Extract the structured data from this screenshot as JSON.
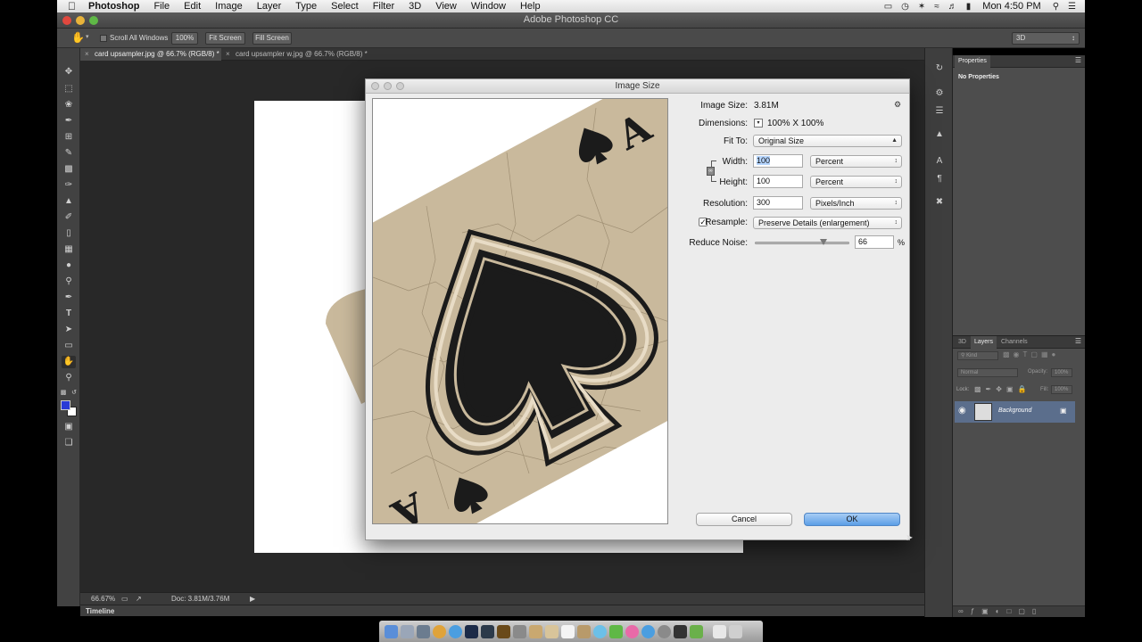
{
  "menubar": {
    "app_name": "Photoshop",
    "menus": [
      "File",
      "Edit",
      "Image",
      "Layer",
      "Type",
      "Select",
      "Filter",
      "3D",
      "View",
      "Window",
      "Help"
    ],
    "clock": "Mon 4:50 PM"
  },
  "window": {
    "title": "Adobe Photoshop CC"
  },
  "options_bar": {
    "scroll_all_windows": "Scroll All Windows",
    "zoom_btn": "100%",
    "fit_screen_btn": "Fit Screen",
    "fill_screen_btn": "Fill Screen",
    "workspace": "3D"
  },
  "tabs": [
    {
      "label": "card upsampler.jpg @ 66.7% (RGB/8) *"
    },
    {
      "label": "card upsampler w.jpg @ 66.7% (RGB/8) *"
    }
  ],
  "status": {
    "zoom": "66.67%",
    "doc": "Doc: 3.81M/3.76M",
    "timeline": "Timeline"
  },
  "properties_panel": {
    "tab": "Properties",
    "empty_text": "No Properties"
  },
  "layers_panel": {
    "tabs": [
      "3D",
      "Layers",
      "Channels"
    ],
    "filter": "Kind",
    "blend_mode": "Normal",
    "opacity_label": "Opacity:",
    "opacity_value": "100%",
    "lock_label": "Lock:",
    "fill_label": "Fill:",
    "fill_value": "100%",
    "layer_name": "Background"
  },
  "dialog": {
    "title": "Image Size",
    "image_size_label": "Image Size:",
    "image_size_value": "3.81M",
    "dimensions_label": "Dimensions:",
    "dimensions_value": "100%  X  100%",
    "fit_to_label": "Fit To:",
    "fit_to_value": "Original Size",
    "width_label": "Width:",
    "width_value": "100",
    "width_unit": "Percent",
    "height_label": "Height:",
    "height_value": "100",
    "height_unit": "Percent",
    "resolution_label": "Resolution:",
    "resolution_value": "300",
    "resolution_unit": "Pixels/Inch",
    "resample_label": "Resample:",
    "resample_checked": true,
    "resample_value": "Preserve Details (enlargement)",
    "reduce_noise_label": "Reduce Noise:",
    "reduce_noise_value": "66",
    "reduce_noise_unit": "%",
    "reduce_noise_fraction": 0.73,
    "cancel_label": "Cancel",
    "ok_label": "OK"
  },
  "colors": {
    "foreground": "#2a3bd6",
    "background": "#ffffff",
    "card": "#c9b99c",
    "ink": "#1b1b1b"
  }
}
